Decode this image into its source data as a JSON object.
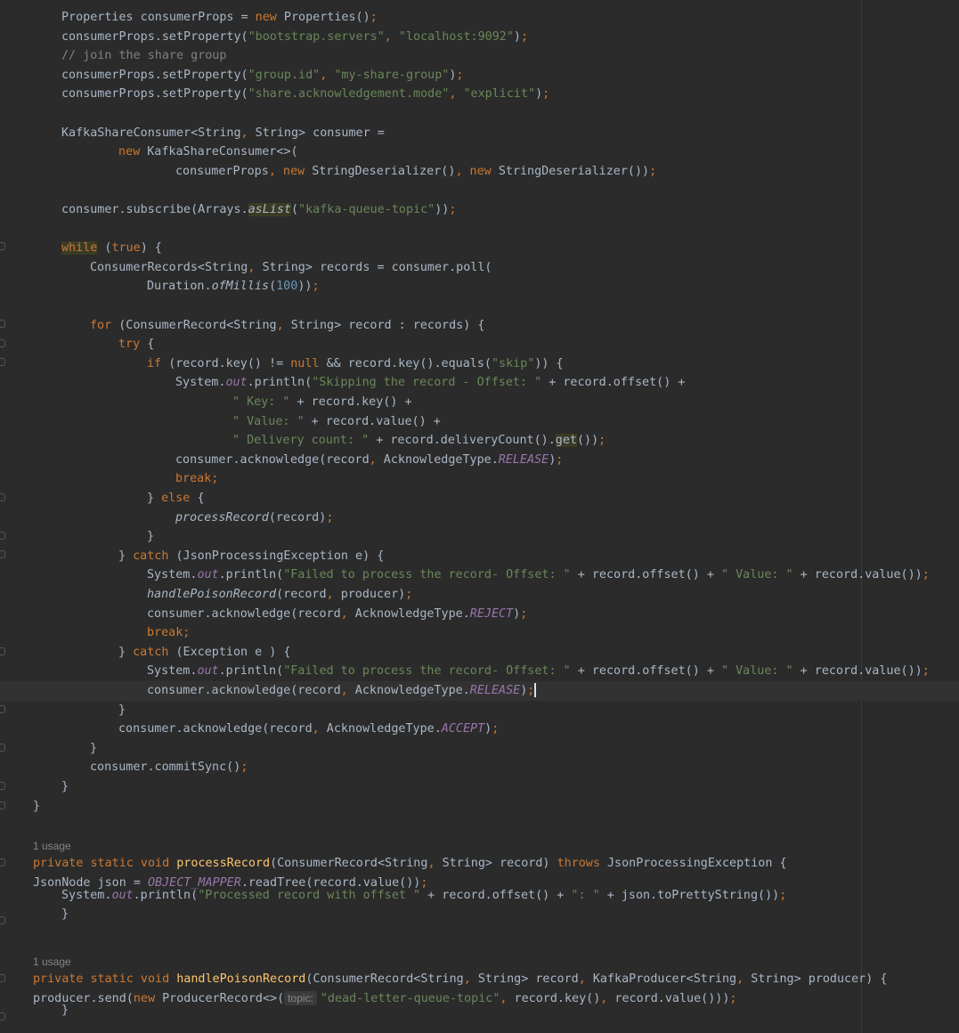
{
  "editor": {
    "usages": [
      "1 usage",
      "1 usage"
    ],
    "inlay_hint": "topic:",
    "lines": [
      [
        [
          "t",
          "Properties consumerProps = "
        ],
        [
          "k",
          "new "
        ],
        [
          "t",
          "Properties()"
        ],
        [
          "k",
          ";"
        ]
      ],
      [
        [
          "t",
          "consumerProps.setProperty("
        ],
        [
          "s",
          "\"bootstrap.servers\""
        ],
        [
          "k",
          ", "
        ],
        [
          "s",
          "\"localhost:9092\""
        ],
        [
          "t",
          ")"
        ],
        [
          "k",
          ";"
        ]
      ],
      [
        [
          "c",
          "// join the share group"
        ]
      ],
      [
        [
          "t",
          "consumerProps.setProperty("
        ],
        [
          "s",
          "\"group.id\""
        ],
        [
          "k",
          ", "
        ],
        [
          "s",
          "\"my-share-group\""
        ],
        [
          "t",
          ")"
        ],
        [
          "k",
          ";"
        ]
      ],
      [
        [
          "t",
          "consumerProps.setProperty("
        ],
        [
          "s",
          "\"share.acknowledgement.mode\""
        ],
        [
          "k",
          ", "
        ],
        [
          "s",
          "\"explicit\""
        ],
        [
          "t",
          ")"
        ],
        [
          "k",
          ";"
        ]
      ],
      [],
      [
        [
          "t",
          "KafkaShareConsumer<String"
        ],
        [
          "k",
          ", "
        ],
        [
          "t",
          "String> consumer ="
        ]
      ],
      [
        [
          "k",
          "new "
        ],
        [
          "t",
          "KafkaShareConsumer<>("
        ]
      ],
      [
        [
          "t",
          "consumerProps"
        ],
        [
          "k",
          ", new "
        ],
        [
          "t",
          "StringDeserializer()"
        ],
        [
          "k",
          ", new "
        ],
        [
          "t",
          "StringDeserializer())"
        ],
        [
          "k",
          ";"
        ]
      ],
      [],
      [
        [
          "t",
          "consumer.subscribe(Arrays."
        ],
        [
          "fi-hl",
          "asList"
        ],
        [
          "t",
          "("
        ],
        [
          "s",
          "\"kafka-queue-topic\""
        ],
        [
          "t",
          "))"
        ],
        [
          "k",
          ";"
        ]
      ],
      [],
      [
        [
          "k-hl",
          "while"
        ],
        [
          "t",
          " ("
        ],
        [
          "k",
          "true"
        ],
        [
          "t",
          ") {"
        ]
      ],
      [
        [
          "t",
          "ConsumerRecords<String"
        ],
        [
          "k",
          ", "
        ],
        [
          "t",
          "String> records = consumer.poll("
        ]
      ],
      [
        [
          "t",
          "Duration."
        ],
        [
          "fi",
          "ofMillis"
        ],
        [
          "t",
          "("
        ],
        [
          "n",
          "100"
        ],
        [
          "t",
          "))"
        ],
        [
          "k",
          ";"
        ]
      ],
      [],
      [
        [
          "k",
          "for "
        ],
        [
          "t",
          "(ConsumerRecord<String"
        ],
        [
          "k",
          ", "
        ],
        [
          "t",
          "String> record : records) {"
        ]
      ],
      [
        [
          "k",
          "try "
        ],
        [
          "t",
          "{"
        ]
      ],
      [
        [
          "k",
          "if "
        ],
        [
          "t",
          "(record.key() != "
        ],
        [
          "k",
          "null "
        ],
        [
          "t",
          "&& record.key().equals("
        ],
        [
          "s",
          "\"skip\""
        ],
        [
          "t",
          ")) {"
        ]
      ],
      [
        [
          "t",
          "System."
        ],
        [
          "st",
          "out"
        ],
        [
          "t",
          ".println("
        ],
        [
          "s",
          "\"Skipping the record - Offset: \""
        ],
        [
          "t",
          " + record.offset() +"
        ]
      ],
      [
        [
          "s",
          "\" Key: \""
        ],
        [
          "t",
          " + record.key() +"
        ]
      ],
      [
        [
          "s",
          "\" Value: \""
        ],
        [
          "t",
          " + record.value() +"
        ]
      ],
      [
        [
          "s",
          "\" Delivery count: \""
        ],
        [
          "t",
          " + record.deliveryCount()."
        ],
        [
          "t-hl",
          "get"
        ],
        [
          "t",
          "())"
        ],
        [
          "k",
          ";"
        ]
      ],
      [
        [
          "t",
          "consumer.acknowledge(record"
        ],
        [
          "k",
          ", "
        ],
        [
          "t",
          "AcknowledgeType."
        ],
        [
          "st",
          "RELEASE"
        ],
        [
          "t",
          ")"
        ],
        [
          "k",
          ";"
        ]
      ],
      [
        [
          "k",
          "break;"
        ]
      ],
      [
        [
          "t",
          "} "
        ],
        [
          "k",
          "else "
        ],
        [
          "t",
          "{"
        ]
      ],
      [
        [
          "fi",
          "processRecord"
        ],
        [
          "t",
          "(record)"
        ],
        [
          "k",
          ";"
        ]
      ],
      [
        [
          "t",
          "}"
        ]
      ],
      [
        [
          "t",
          "} "
        ],
        [
          "k",
          "catch "
        ],
        [
          "t",
          "(JsonProcessingException e) {"
        ]
      ],
      [
        [
          "t",
          "System."
        ],
        [
          "st",
          "out"
        ],
        [
          "t",
          ".println("
        ],
        [
          "s",
          "\"Failed to process the record- Offset: \""
        ],
        [
          "t",
          " + record.offset() + "
        ],
        [
          "s",
          "\" Value: \""
        ],
        [
          "t",
          " + record.value())"
        ],
        [
          "k",
          ";"
        ]
      ],
      [
        [
          "fi",
          "handlePoisonRecord"
        ],
        [
          "t",
          "(record"
        ],
        [
          "k",
          ", "
        ],
        [
          "t",
          "producer)"
        ],
        [
          "k",
          ";"
        ]
      ],
      [
        [
          "t",
          "consumer.acknowledge(record"
        ],
        [
          "k",
          ", "
        ],
        [
          "t",
          "AcknowledgeType."
        ],
        [
          "st",
          "REJECT"
        ],
        [
          "t",
          ")"
        ],
        [
          "k",
          ";"
        ]
      ],
      [
        [
          "k",
          "break;"
        ]
      ],
      [
        [
          "t",
          "} "
        ],
        [
          "k",
          "catch "
        ],
        [
          "t",
          "(Exception e ) {"
        ]
      ],
      [
        [
          "t",
          "System."
        ],
        [
          "st",
          "out"
        ],
        [
          "t",
          ".println("
        ],
        [
          "s",
          "\"Failed to process the record- Offset: \""
        ],
        [
          "t",
          " + record.offset() + "
        ],
        [
          "s",
          "\" Value: \""
        ],
        [
          "t",
          " + record.value())"
        ],
        [
          "k",
          ";"
        ]
      ],
      [
        [
          "t",
          "consumer.acknowledge(record"
        ],
        [
          "k",
          ", "
        ],
        [
          "t",
          "AcknowledgeType."
        ],
        [
          "st",
          "RELEASE"
        ],
        [
          "t",
          ")"
        ],
        [
          "k",
          ";"
        ]
      ],
      [
        [
          "t",
          "}"
        ]
      ],
      [
        [
          "t",
          "consumer.acknowledge(record"
        ],
        [
          "k",
          ", "
        ],
        [
          "t",
          "AcknowledgeType."
        ],
        [
          "st",
          "ACCEPT"
        ],
        [
          "t",
          ")"
        ],
        [
          "k",
          ";"
        ]
      ],
      [
        [
          "t",
          "}"
        ]
      ],
      [
        [
          "t",
          "consumer.commitSync()"
        ],
        [
          "k",
          ";"
        ]
      ],
      [
        [
          "t",
          "}"
        ]
      ],
      [
        [
          "t",
          "}"
        ]
      ],
      [],
      [],
      [
        [
          "k",
          "private static void "
        ],
        [
          "m",
          "processRecord"
        ],
        [
          "t",
          "(ConsumerRecord<String"
        ],
        [
          "k",
          ", "
        ],
        [
          "t",
          "String> record) "
        ],
        [
          "k",
          "throws "
        ],
        [
          "t",
          "JsonProcessingException {"
        ]
      ],
      [
        [
          "t",
          "JsonNode json = "
        ],
        [
          "st",
          "OBJECT_MAPPER"
        ],
        [
          "t",
          ".readTree(record.value())"
        ],
        [
          "k",
          ";"
        ]
      ],
      [
        [
          "t",
          "System."
        ],
        [
          "st",
          "out"
        ],
        [
          "t",
          ".println("
        ],
        [
          "s",
          "\"Processed record with offset \""
        ],
        [
          "t",
          " + record.offset() + "
        ],
        [
          "s",
          "\": \""
        ],
        [
          "t",
          " + json.toPrettyString())"
        ],
        [
          "k",
          ";"
        ]
      ],
      [
        [
          "t",
          "}"
        ]
      ],
      [],
      [],
      [
        [
          "k",
          "private static void "
        ],
        [
          "m",
          "handlePoisonRecord"
        ],
        [
          "t",
          "(ConsumerRecord<String"
        ],
        [
          "k",
          ", "
        ],
        [
          "t",
          "String> record"
        ],
        [
          "k",
          ", "
        ],
        [
          "t",
          "KafkaProducer<String"
        ],
        [
          "k",
          ", "
        ],
        [
          "t",
          "String> producer) {"
        ]
      ],
      [
        [
          "t",
          "producer.send("
        ],
        [
          "k",
          "new "
        ],
        [
          "t",
          "ProducerRecord<>("
        ],
        [
          "hint",
          "topic:"
        ],
        [
          "s",
          "\"dead-letter-queue-topic\""
        ],
        [
          "k",
          ", "
        ],
        [
          "t",
          "record.key()"
        ],
        [
          "k",
          ", "
        ],
        [
          "t",
          "record.value()))"
        ],
        [
          "k",
          ";"
        ]
      ],
      [
        [
          "t",
          "}"
        ]
      ]
    ]
  }
}
